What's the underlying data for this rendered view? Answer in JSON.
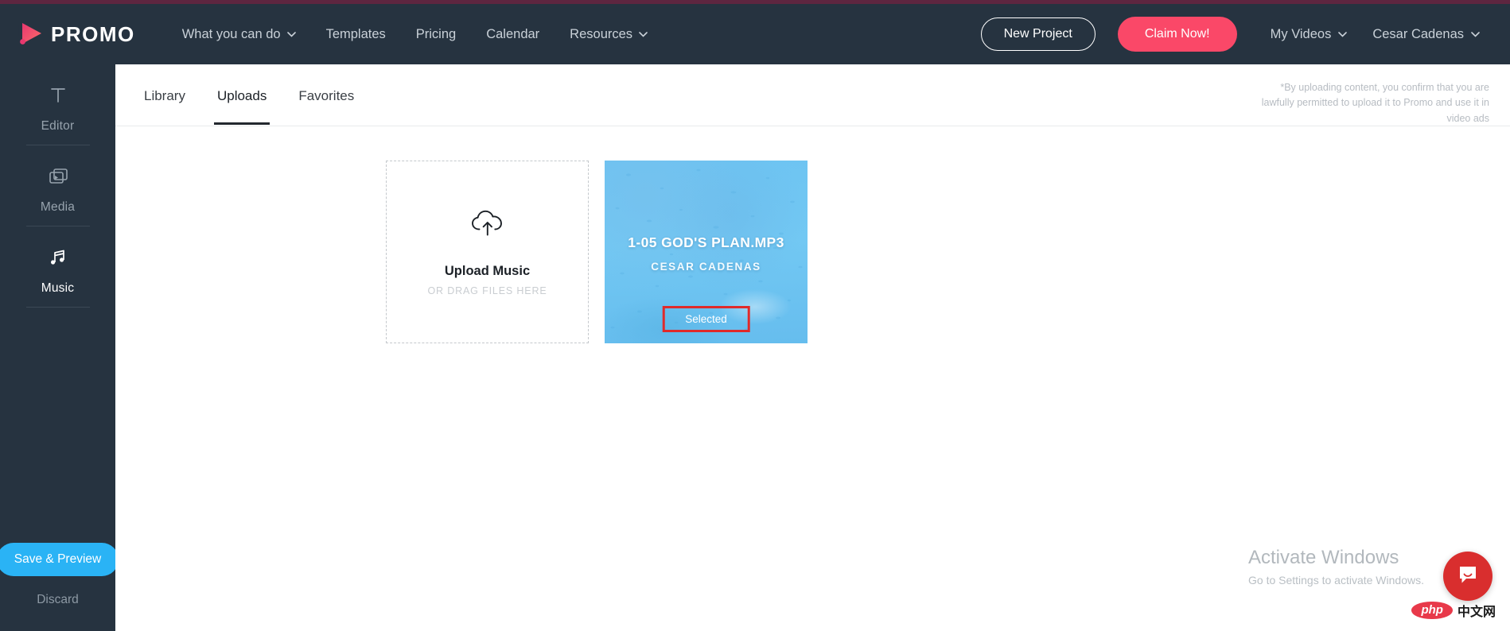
{
  "brand": {
    "name": "PROMO",
    "accent": "#fa4868",
    "logo_icon": "promo-play-logo"
  },
  "header": {
    "nav": [
      {
        "label": "What you can do",
        "has_caret": true
      },
      {
        "label": "Templates",
        "has_caret": false
      },
      {
        "label": "Pricing",
        "has_caret": false
      },
      {
        "label": "Calendar",
        "has_caret": false
      },
      {
        "label": "Resources",
        "has_caret": true
      }
    ],
    "new_project_label": "New Project",
    "claim_label": "Claim Now!",
    "my_videos_label": "My Videos",
    "account_label": "Cesar Cadenas"
  },
  "sidebar": {
    "items": [
      {
        "label": "Editor",
        "icon": "text-tool-icon",
        "active": false
      },
      {
        "label": "Media",
        "icon": "media-frames-icon",
        "active": false
      },
      {
        "label": "Music",
        "icon": "music-note-icon",
        "active": true
      }
    ],
    "save_label": "Save & Preview",
    "discard_label": "Discard",
    "save_color": "#2ab3f5"
  },
  "main": {
    "tabs": [
      {
        "label": "Library",
        "active": false
      },
      {
        "label": "Uploads",
        "active": true
      },
      {
        "label": "Favorites",
        "active": false
      }
    ],
    "disclaimer": "*By uploading content, you confirm that you are lawfully permitted to upload it to Promo and use it in video ads",
    "dropzone": {
      "icon": "cloud-upload-icon",
      "title": "Upload Music",
      "subtitle": "OR DRAG FILES HERE"
    },
    "music_cards": [
      {
        "title": "1-05 GOD'S PLAN.MP3",
        "artist": "CESAR CADENAS",
        "action_label": "Selected",
        "highlight_color": "#e02a2a"
      }
    ]
  },
  "watermarks": {
    "activate_title": "Activate Windows",
    "activate_sub": "Go to Settings to activate Windows.",
    "php_label": "php",
    "php_cn_label": "中文网"
  },
  "chat": {
    "icon": "chat-bubble-icon",
    "color": "#d92e2e"
  }
}
